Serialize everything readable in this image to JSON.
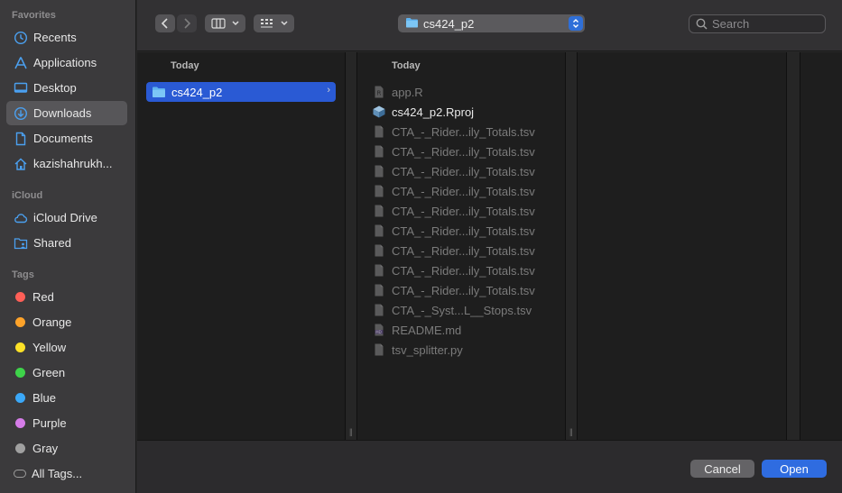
{
  "sidebar": {
    "favorites_title": "Favorites",
    "favorites": [
      {
        "label": "Recents",
        "icon": "clock-icon"
      },
      {
        "label": "Applications",
        "icon": "applications-icon"
      },
      {
        "label": "Desktop",
        "icon": "desktop-icon"
      },
      {
        "label": "Downloads",
        "icon": "downloads-icon",
        "selected": true
      },
      {
        "label": "Documents",
        "icon": "document-icon"
      },
      {
        "label": "kazishahrukh...",
        "icon": "home-icon"
      }
    ],
    "icloud_title": "iCloud",
    "icloud": [
      {
        "label": "iCloud Drive",
        "icon": "cloud-icon"
      },
      {
        "label": "Shared",
        "icon": "shared-folder-icon"
      }
    ],
    "tags_title": "Tags",
    "tags": [
      {
        "label": "Red",
        "color": "#ff5f57"
      },
      {
        "label": "Orange",
        "color": "#fea32a"
      },
      {
        "label": "Yellow",
        "color": "#fde127"
      },
      {
        "label": "Green",
        "color": "#3ed34a"
      },
      {
        "label": "Blue",
        "color": "#3ba8f8"
      },
      {
        "label": "Purple",
        "color": "#d57ce8"
      },
      {
        "label": "Gray",
        "color": "#a0a0a0"
      },
      {
        "label": "All Tags...",
        "color": ""
      }
    ]
  },
  "toolbar": {
    "path_label": "cs424_p2",
    "search_placeholder": "Search"
  },
  "columns": [
    {
      "header": "Today",
      "items": [
        {
          "name": "cs424_p2",
          "kind": "folder",
          "selected": true
        }
      ]
    },
    {
      "header": "Today",
      "items": [
        {
          "name": "app.R",
          "kind": "r-file",
          "enabled": false
        },
        {
          "name": "cs424_p2.Rproj",
          "kind": "rproj-file",
          "enabled": true
        },
        {
          "name": "CTA_-_Rider...ily_Totals.tsv",
          "kind": "file",
          "enabled": false
        },
        {
          "name": "CTA_-_Rider...ily_Totals.tsv",
          "kind": "file",
          "enabled": false
        },
        {
          "name": "CTA_-_Rider...ily_Totals.tsv",
          "kind": "file",
          "enabled": false
        },
        {
          "name": "CTA_-_Rider...ily_Totals.tsv",
          "kind": "file",
          "enabled": false
        },
        {
          "name": "CTA_-_Rider...ily_Totals.tsv",
          "kind": "file",
          "enabled": false
        },
        {
          "name": "CTA_-_Rider...ily_Totals.tsv",
          "kind": "file",
          "enabled": false
        },
        {
          "name": "CTA_-_Rider...ily_Totals.tsv",
          "kind": "file",
          "enabled": false
        },
        {
          "name": "CTA_-_Rider...ily_Totals.tsv",
          "kind": "file",
          "enabled": false
        },
        {
          "name": "CTA_-_Rider...ily_Totals.tsv",
          "kind": "file",
          "enabled": false
        },
        {
          "name": "CTA_-_Syst...L__Stops.tsv",
          "kind": "file",
          "enabled": false
        },
        {
          "name": "README.md",
          "kind": "md-file",
          "enabled": false
        },
        {
          "name": "tsv_splitter.py",
          "kind": "file",
          "enabled": false
        }
      ]
    }
  ],
  "buttons": {
    "cancel": "Cancel",
    "open": "Open"
  },
  "colors": {
    "accent": "#2f6ce0",
    "selection": "#2a5ad4"
  }
}
